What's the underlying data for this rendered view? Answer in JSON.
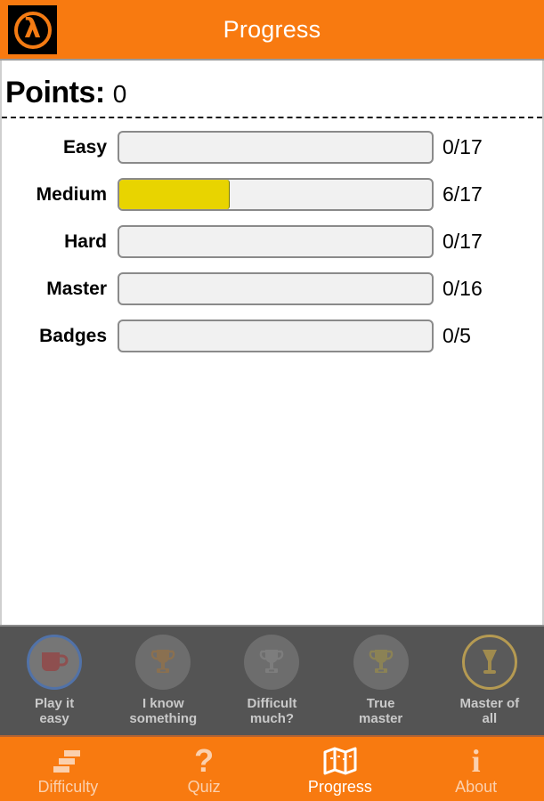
{
  "header": {
    "title": "Progress",
    "logo_icon": "half-life-lambda-icon",
    "background_color": "#F87A10"
  },
  "main": {
    "points_label": "Points:",
    "points_value": "0",
    "bars": [
      {
        "label": "Easy",
        "ratio": "0/17",
        "current": 0,
        "total": 17,
        "percent": 0
      },
      {
        "label": "Medium",
        "ratio": "6/17",
        "current": 6,
        "total": 17,
        "percent": 35
      },
      {
        "label": "Hard",
        "ratio": "0/17",
        "current": 0,
        "total": 17,
        "percent": 0
      },
      {
        "label": "Master",
        "ratio": "0/16",
        "current": 0,
        "total": 16,
        "percent": 0
      },
      {
        "label": "Badges",
        "ratio": "0/5",
        "current": 0,
        "total": 5,
        "percent": 0
      }
    ],
    "fill_color": "#E8D400",
    "track_color": "#F1F1F1"
  },
  "badges": {
    "background_color": "#545454",
    "items": [
      {
        "label": "Play it easy",
        "line1": "Play it",
        "line2": "easy",
        "icon": "mug-icon",
        "ring": "blue"
      },
      {
        "label": "I know something",
        "line1": "I know",
        "line2": "something",
        "icon": "trophy-icon",
        "ring": "none"
      },
      {
        "label": "Difficult much?",
        "line1": "Difficult",
        "line2": "much?",
        "icon": "trophy-icon",
        "ring": "none"
      },
      {
        "label": "True master",
        "line1": "True",
        "line2": "master",
        "icon": "trophy-icon",
        "ring": "none"
      },
      {
        "label": "Master of all",
        "line1": "Master of",
        "line2": "all",
        "icon": "chalice-icon",
        "ring": "gold"
      }
    ]
  },
  "tabbar": {
    "background_color": "#F87A10",
    "active_tab": "Progress",
    "tabs": [
      {
        "label": "Difficulty",
        "icon": "bars-icon",
        "active": false
      },
      {
        "label": "Quiz",
        "icon": "question-icon",
        "active": false
      },
      {
        "label": "Progress",
        "icon": "map-icon",
        "active": true
      },
      {
        "label": "About",
        "icon": "info-icon",
        "active": false
      }
    ]
  }
}
